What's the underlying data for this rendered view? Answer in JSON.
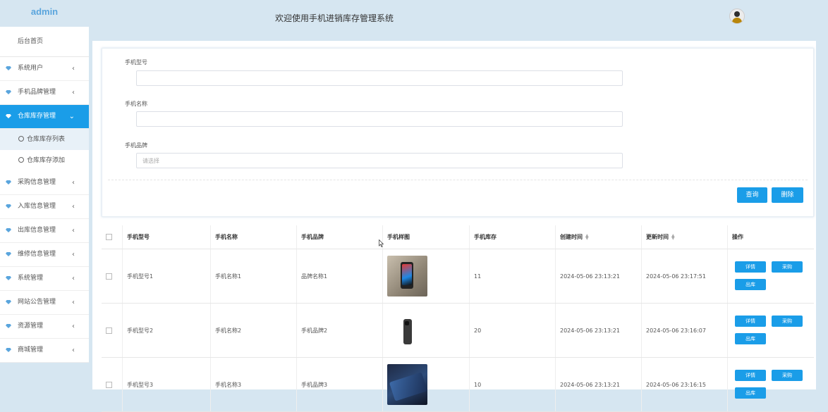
{
  "sidebar": {
    "logo": "admin",
    "home": "后台首页",
    "items": [
      {
        "label": "系统用户"
      },
      {
        "label": "手机品牌管理"
      },
      {
        "label": "仓库库存管理"
      },
      {
        "label": "采购信息管理"
      },
      {
        "label": "入库信息管理"
      },
      {
        "label": "出库信息管理"
      },
      {
        "label": "维修信息管理"
      },
      {
        "label": "系统管理"
      },
      {
        "label": "网站公告管理"
      },
      {
        "label": "资源管理"
      },
      {
        "label": "商城管理"
      }
    ],
    "submenu": [
      {
        "label": "仓库库存列表"
      },
      {
        "label": "仓库库存添加"
      }
    ],
    "active_item": "仓库库存管理"
  },
  "header": {
    "title": "欢迎使用手机进销库存管理系统"
  },
  "search": {
    "model_label": "手机型号",
    "model_value": "",
    "name_label": "手机名称",
    "name_value": "",
    "brand_label": "手机品牌",
    "brand_placeholder": "请选择",
    "query_button": "查询",
    "delete_button": "删除"
  },
  "table": {
    "columns": [
      "手机型号",
      "手机名称",
      "手机品牌",
      "手机样图",
      "手机库存",
      "创建时间",
      "更新时间",
      "操作"
    ],
    "rows": [
      {
        "model": "手机型号1",
        "name": "手机名称1",
        "brand": "品牌名称1",
        "stock": "11",
        "created": "2024-05-06 23:13:21",
        "updated": "2024-05-06 23:17:51"
      },
      {
        "model": "手机型号2",
        "name": "手机名称2",
        "brand": "手机品牌2",
        "stock": "20",
        "created": "2024-05-06 23:13:21",
        "updated": "2024-05-06 23:16:07"
      },
      {
        "model": "手机型号3",
        "name": "手机名称3",
        "brand": "手机品牌3",
        "stock": "10",
        "created": "2024-05-06 23:13:21",
        "updated": "2024-05-06 23:16:15"
      }
    ],
    "actions": {
      "detail": "详情",
      "purchase": "采购",
      "outbound": "出库"
    }
  },
  "colors": {
    "accent": "#1a9de8",
    "background": "#d6e6f1",
    "logo": "#5aa5dd"
  }
}
